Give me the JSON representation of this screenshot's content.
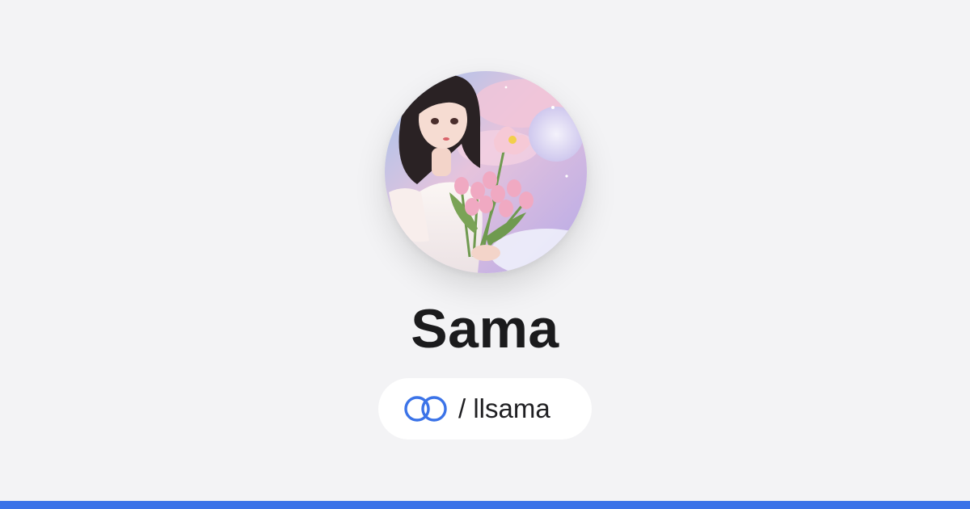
{
  "profile": {
    "name": "Sama",
    "handle": "/ llsama",
    "avatar_icon": "profile-avatar-illustration"
  },
  "link_icon": "linked-rings-icon",
  "colors": {
    "background": "#f3f3f5",
    "accent": "#3b73e8",
    "name_text": "#1b1b1d"
  }
}
